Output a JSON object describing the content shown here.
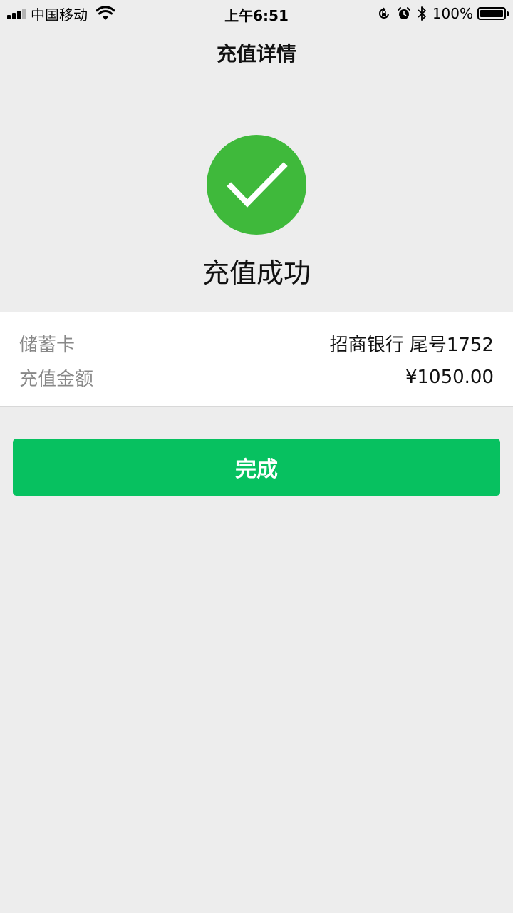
{
  "status_bar": {
    "carrier": "中国移动",
    "time": "上午6:51",
    "battery_percent": "100%",
    "icons": [
      "signal-icon",
      "wifi-icon",
      "orientation-lock-icon",
      "alarm-icon",
      "bluetooth-icon",
      "battery-icon"
    ],
    "battery_level": 1.0
  },
  "nav": {
    "title": "充值详情"
  },
  "result": {
    "icon": "checkmark-circle-icon",
    "icon_color": "#3fb93b",
    "text": "充值成功"
  },
  "details": {
    "rows": [
      {
        "label": "储蓄卡",
        "value": "招商银行 尾号1752"
      },
      {
        "label": "充值金额",
        "value": "¥1050.00"
      }
    ]
  },
  "actions": {
    "done_label": "完成",
    "accent_color": "#07c160"
  }
}
